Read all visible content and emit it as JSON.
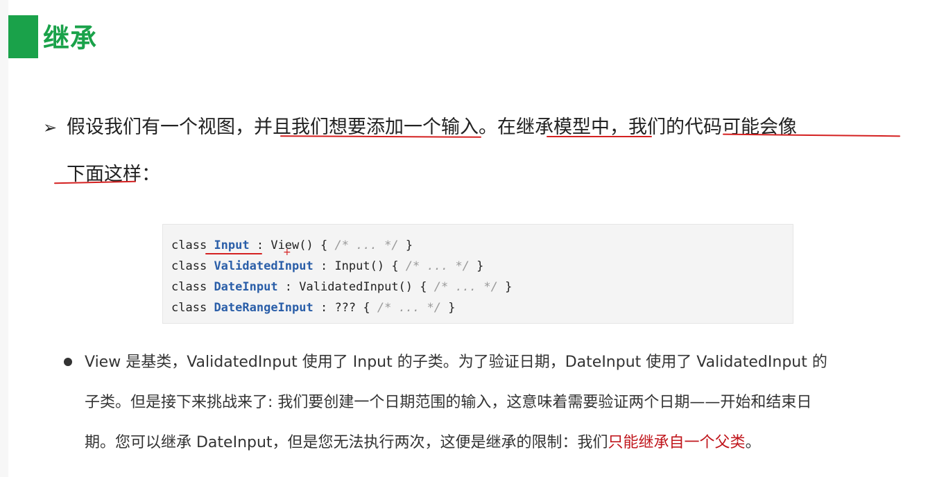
{
  "title": "继承",
  "bullet1": {
    "arrow": "➢",
    "line1": "假设我们有一个视图，并且我们想要添加一个输入。在继承模型中，我们的代码可能会像",
    "line2": "下面这样："
  },
  "code": {
    "lines": [
      {
        "kw": "class",
        "name": "Input",
        "rest": " : View() { ",
        "comment": "/* ... */",
        "end": " }"
      },
      {
        "kw": "class",
        "name": "ValidatedInput",
        "rest": " : Input() { ",
        "comment": "/* ... */",
        "end": " }"
      },
      {
        "kw": "class",
        "name": "DateInput",
        "rest": " : ValidatedInput() { ",
        "comment": "/* ... */",
        "end": " }"
      },
      {
        "kw": "class",
        "name": "DateRangeInput",
        "rest": " : ??? { ",
        "comment": "/* ... */",
        "end": " }"
      }
    ]
  },
  "bullet2": {
    "line1": "View 是基类，ValidatedInput 使用了 Input 的子类。为了验证日期，DateInput 使用了 ValidatedInput 的",
    "line2": "子类。但是接下来挑战来了: 我们要创建一个日期范围的输入，这意味着需要验证两个日期——开始和结束日",
    "line3_prefix": "期。您可以继承 DateInput，但是您无法执行两次，这便是继承的限制：我们",
    "line3_highlight": "只能继承自一个父类",
    "line3_suffix": "。"
  },
  "colors": {
    "accent": "#1aa24a",
    "highlight": "#c0161c",
    "annotation": "#d42020",
    "code_class": "#2a5ea8"
  }
}
